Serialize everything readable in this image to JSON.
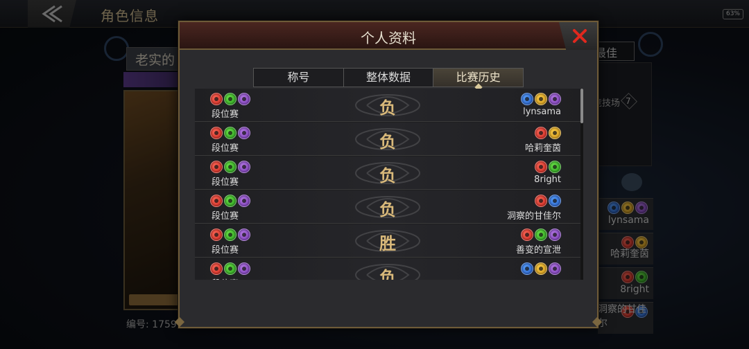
{
  "topbar": {
    "title": "角色信息",
    "battery": "63%"
  },
  "background": {
    "player_name": "老实的",
    "player_id": "编号: 1759",
    "right_tab": "最佳",
    "arena_label": "竞技场",
    "arena_count": "7",
    "right_list": [
      {
        "name": "lynsama",
        "icons": [
          "blue-icon",
          "gold-icon",
          "purple-icon"
        ]
      },
      {
        "name": "哈莉奎茵",
        "icons": [
          "red-icon",
          "gold-icon"
        ]
      },
      {
        "name": "8right",
        "icons": [
          "red-icon",
          "green-icon"
        ]
      },
      {
        "name": "洞察的甘佳尔",
        "icons": [
          "red-icon",
          "blue-icon"
        ]
      }
    ]
  },
  "dialog": {
    "title": "个人资料",
    "close_icon": "close-icon",
    "tabs": [
      {
        "label": "称号",
        "active": false
      },
      {
        "label": "整体数据",
        "active": false
      },
      {
        "label": "比赛历史",
        "active": true
      }
    ],
    "matches": [
      {
        "mode": "段位赛",
        "result": "负",
        "opponent": "lynsama",
        "my_icons": [
          "red",
          "green",
          "purple"
        ],
        "opp_icons": [
          "blue",
          "gold",
          "purple"
        ]
      },
      {
        "mode": "段位赛",
        "result": "负",
        "opponent": "哈莉奎茵",
        "my_icons": [
          "red",
          "green",
          "purple"
        ],
        "opp_icons": [
          "red",
          "gold"
        ]
      },
      {
        "mode": "段位赛",
        "result": "负",
        "opponent": "8right",
        "my_icons": [
          "red",
          "green",
          "purple"
        ],
        "opp_icons": [
          "red",
          "green"
        ]
      },
      {
        "mode": "段位赛",
        "result": "负",
        "opponent": "洞察的甘佳尔",
        "my_icons": [
          "red",
          "green",
          "purple"
        ],
        "opp_icons": [
          "red",
          "blue"
        ]
      },
      {
        "mode": "段位赛",
        "result": "胜",
        "opponent": "善变的宣泄",
        "my_icons": [
          "red",
          "green",
          "purple"
        ],
        "opp_icons": [
          "red",
          "green",
          "purple"
        ]
      },
      {
        "mode": "段位赛",
        "result": "负",
        "opponent": "",
        "my_icons": [
          "red",
          "green",
          "purple"
        ],
        "opp_icons": [
          "blue",
          "gold",
          "purple"
        ]
      }
    ]
  },
  "colors": {
    "accent_gold": "#d9b97a",
    "header_red": "#4a2620",
    "close_red": "#e0281e"
  }
}
